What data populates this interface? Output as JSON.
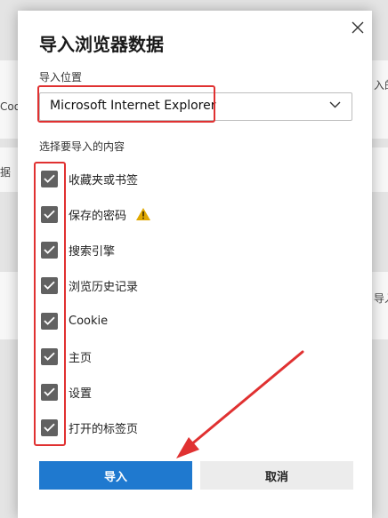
{
  "background": {
    "fragments": [
      "Coo",
      "据",
      "入的",
      "导入"
    ]
  },
  "dialog": {
    "title": "导入浏览器数据",
    "location_label": "导入位置",
    "browser_selected": "Microsoft Internet Explorer",
    "content_label": "选择要导入的内容",
    "items": [
      {
        "label": "收藏夹或书签",
        "checked": true
      },
      {
        "label": "保存的密码",
        "checked": true,
        "warning": true
      },
      {
        "label": "搜索引擎",
        "checked": true
      },
      {
        "label": "浏览历史记录",
        "checked": true
      },
      {
        "label": "Cookie",
        "checked": true
      },
      {
        "label": "主页",
        "checked": true
      },
      {
        "label": "设置",
        "checked": true
      },
      {
        "label": "打开的标签页",
        "checked": true
      }
    ],
    "import_button": "导入",
    "cancel_button": "取消"
  },
  "colors": {
    "primary": "#1f79cf",
    "checkbox": "#616161",
    "annotation": "#e03131",
    "warning": "#e0a800"
  },
  "icons": {
    "close": "close-icon",
    "chevron": "chevron-down-icon",
    "check": "check-icon",
    "warning": "warning-icon"
  }
}
